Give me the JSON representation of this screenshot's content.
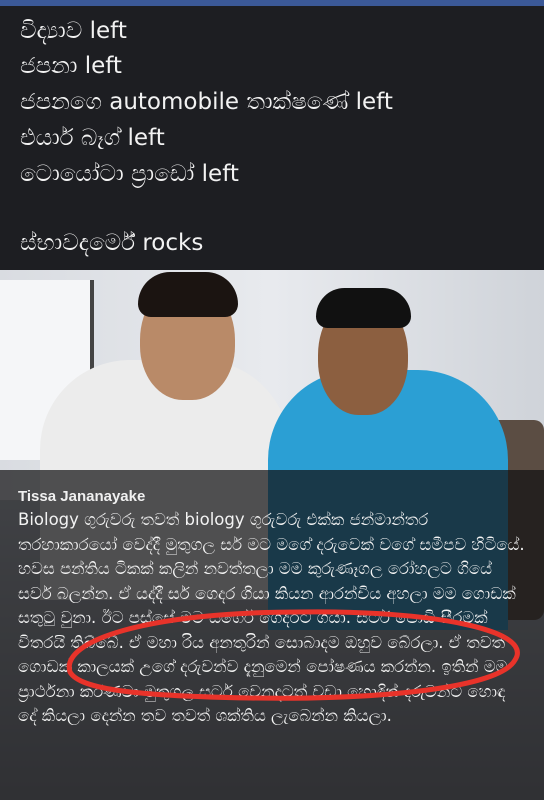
{
  "header": {
    "lines": [
      "විද්‍යාව left",
      "ජපනා left",
      "ජපනගෙ automobile තාක්ෂණේ left",
      "එයාර් බෑග් left",
      "ටොයෝටා ප්‍රාඩෝ left",
      "ස්භාවදර්මේ rocks"
    ]
  },
  "post": {
    "author": "Tissa Jananayake",
    "body": "Biology ගුරුවරු තවත් biology ගුරුවරු එක්ක ජන්මාන්තර තරහාකාරයෝ වෙද්දී මුතුගල සර් මට මගේ දරුවෙක් වගේ සමීපව හිටියේ. හවස පන්තිය ටිකක් කලින් නවත්තලා මම කුරුණෑගල රෝහලට ගියේ සර්ව බලන්න. ඒ යද්දී සර් ගෙදර ගියා කියන ආරන්චිය අහලා මම ගොඩක් සතුටු වුනා. ඊට පස්සේ මම සර්ගේ ගෙදරට ගියා. සර්ට පොඩි සීරමක් විතරයි තිබ්බේ. ඒ මහා රිය අනතුරින් සොබාදම ඔහුව බේරලා. ඒ තවත් ගොඩක් කාලයක් උගේ දරුවන්ව දැනුමෙන් පෝෂණය කරන්න. ඉතින් මම ප්‍රාර්ථනා කරණවා මුතුගල සර්ට වෙනදටත් වඩා හොඳින් දරුවන්ට හොඳ දේ කියලා දෙන්න තව තවත් ශක්තිය ලැබෙන්න කියලා."
  },
  "highlight": {
    "color": "#e8332a"
  }
}
